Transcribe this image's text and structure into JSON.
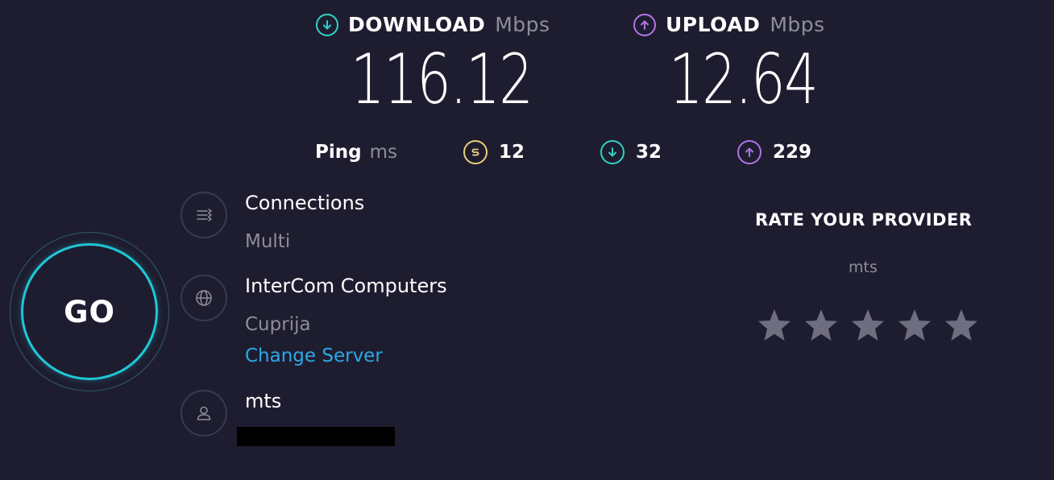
{
  "results": {
    "download": {
      "label": "DOWNLOAD",
      "unit": "Mbps",
      "value": "116.12",
      "icon": "download-arrow-icon",
      "color": "#2fd1c4"
    },
    "upload": {
      "label": "UPLOAD",
      "unit": "Mbps",
      "value": "12.64",
      "icon": "upload-arrow-icon",
      "color": "#b174e8"
    }
  },
  "ping": {
    "label": "Ping",
    "unit": "ms",
    "idle": {
      "value": "12",
      "icon": "ping-icon",
      "color": "#e8d17a"
    },
    "download": {
      "value": "32",
      "icon": "download-arrow-icon",
      "color": "#2fd1c4"
    },
    "upload": {
      "value": "229",
      "icon": "upload-arrow-icon",
      "color": "#b174e8"
    }
  },
  "go_button": {
    "label": "GO",
    "ring_color": "#1fc7d6"
  },
  "connections": {
    "title": "Connections",
    "value": "Multi",
    "icon": "connections-icon"
  },
  "server": {
    "name": "InterCom Computers",
    "location": "Cuprija",
    "change_link": "Change Server",
    "icon": "globe-icon"
  },
  "isp": {
    "name": "mts",
    "icon": "user-icon"
  },
  "rating": {
    "title": "RATE YOUR PROVIDER",
    "provider": "mts",
    "star_count": 5,
    "rating": 0,
    "star_color": "#6f6e80"
  }
}
